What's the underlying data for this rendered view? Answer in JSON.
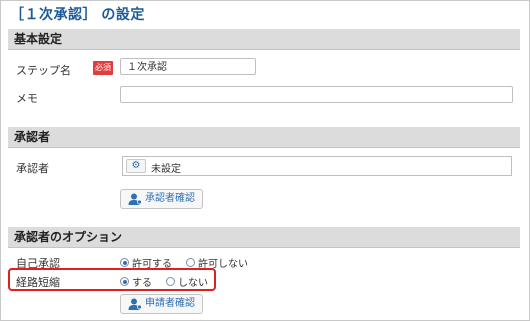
{
  "page": {
    "title": "［１次承認］ の設定"
  },
  "basic": {
    "section_title": "基本設定",
    "step_name_label": "ステップ名",
    "required_badge": "必須",
    "step_name_value": "１次承認",
    "memo_label": "メモ",
    "memo_value": ""
  },
  "approver": {
    "section_title": "承認者",
    "label": "承認者",
    "gear_icon": "gear-icon",
    "value": "未設定",
    "confirm_button": "承認者確認"
  },
  "options": {
    "section_title": "承認者のオプション",
    "self_approval_label": "自己承認",
    "self_approval_yes": "許可する",
    "self_approval_no": "許可しない",
    "self_approval_selected": "許可する",
    "route_shortcut_label": "経路短縮",
    "route_shortcut_yes": "する",
    "route_shortcut_no": "しない",
    "route_shortcut_selected": "する",
    "applicant_confirm_button": "申請者確認"
  },
  "colors": {
    "title": "#1a5a9a",
    "required": "#e23d3d",
    "highlight": "#e02020",
    "accent": "#2e6fb6"
  }
}
